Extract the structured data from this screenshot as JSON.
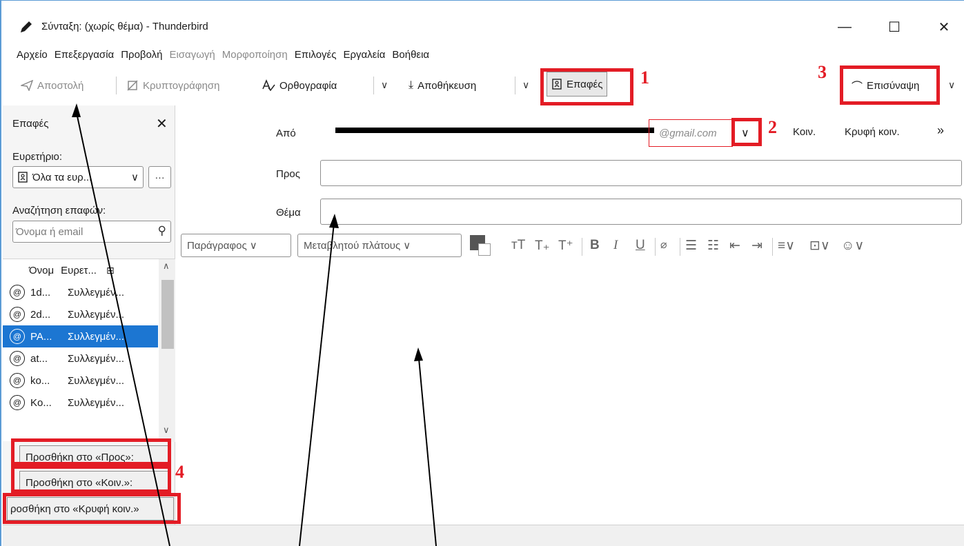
{
  "window": {
    "title": "Σύνταξη: (χωρίς θέμα) - Thunderbird",
    "minimize": "—",
    "maximize": "☐",
    "close": "✕"
  },
  "menubar": [
    {
      "label": "Αρχείο",
      "enabled": true
    },
    {
      "label": "Επεξεργασία",
      "enabled": true
    },
    {
      "label": "Προβολή",
      "enabled": true
    },
    {
      "label": "Εισαγωγή",
      "enabled": false
    },
    {
      "label": "Μορφοποίηση",
      "enabled": false
    },
    {
      "label": "Επιλογές",
      "enabled": true
    },
    {
      "label": "Εργαλεία",
      "enabled": true
    },
    {
      "label": "Βοήθεια",
      "enabled": true
    }
  ],
  "toolbar": {
    "send": "Αποστολή",
    "encrypt": "Κρυπτογράφηση",
    "spelling": "Ορθογραφία",
    "save": "Αποθήκευση",
    "contacts": "Επαφές",
    "attach": "Επισύναψη"
  },
  "annotations": {
    "n1": "1",
    "n2": "2",
    "n3": "3",
    "n4": "4",
    "color": "#e31c25"
  },
  "sidebar": {
    "title": "Επαφές",
    "close": "✕",
    "directory_label": "Ευρετήριο:",
    "directory_value": "Όλα τα ευρ...",
    "more": "···",
    "search_label": "Αναζήτηση επαφών:",
    "search_placeholder": "Όνομα ή email",
    "columns": {
      "name": "Όνομ",
      "book": "Ευρετ..."
    },
    "contacts": [
      {
        "name": "1d...",
        "book": "Συλλεγμέν...",
        "selected": false
      },
      {
        "name": "2d...",
        "book": "Συλλεγμέν...",
        "selected": false
      },
      {
        "name": "PA...",
        "book": "Συλλεγμέν...",
        "selected": true
      },
      {
        "name": "at...",
        "book": "Συλλεγμέν...",
        "selected": false
      },
      {
        "name": "ko...",
        "book": "Συλλεγμέν...",
        "selected": false
      },
      {
        "name": "Ko...",
        "book": "Συλλεγμέν...",
        "selected": false
      }
    ],
    "add_to": "Προσθήκη στο «Προς»:",
    "add_cc": "Προσθήκη στο «Κοιν.»:",
    "add_bcc": "ροσθήκη στο «Κρυφή κοιν.»"
  },
  "header": {
    "from_label": "Από",
    "from_domain": "@gmail.com",
    "cc": "Κοιν.",
    "bcc": "Κρυφή κοιν.",
    "more": "»",
    "to_label": "Προς",
    "to_value": "",
    "subject_label": "Θέμα",
    "subject_value": ""
  },
  "format": {
    "paragraph": "Παράγραφος",
    "font": "Μεταβλητού πλάτους"
  }
}
